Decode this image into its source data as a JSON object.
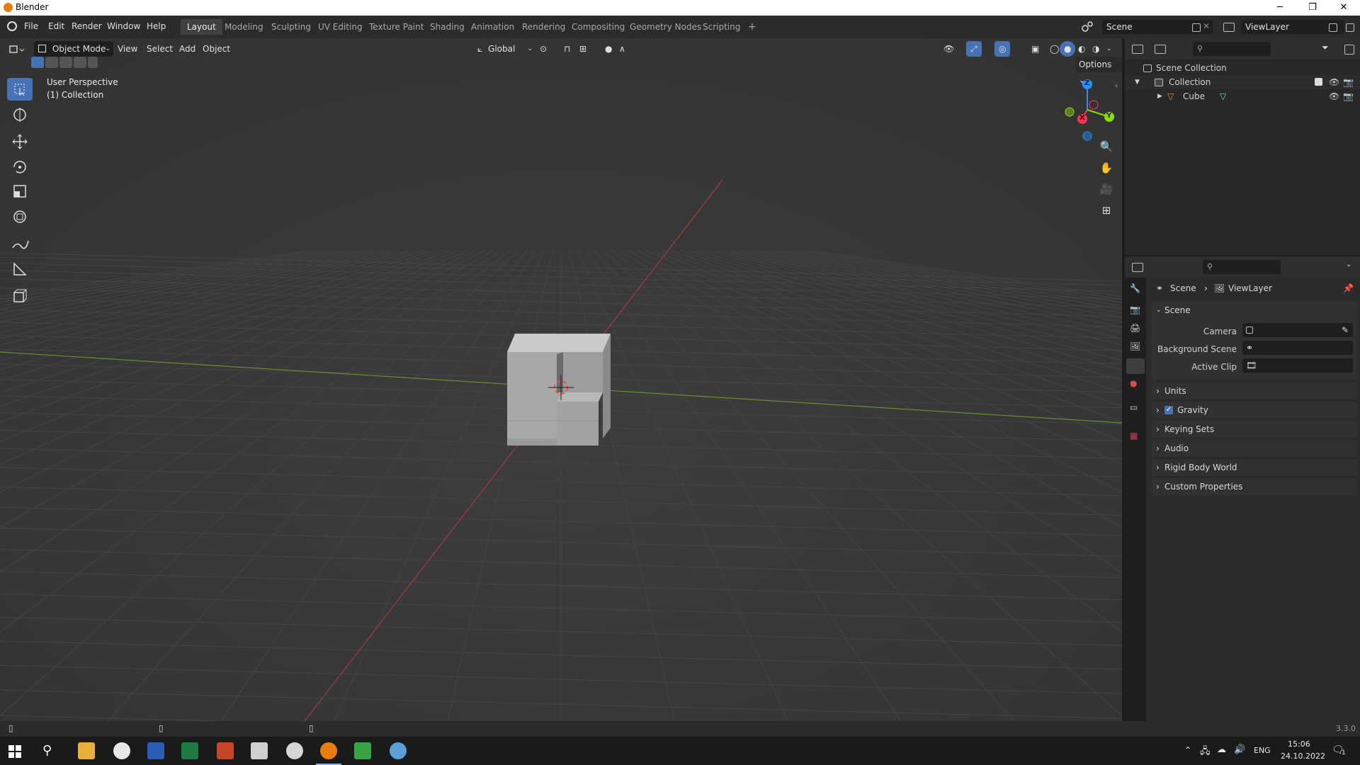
{
  "window": {
    "title": "Blender",
    "controls": [
      "─",
      "❐",
      "✕"
    ]
  },
  "menu": {
    "items": [
      "File",
      "Edit",
      "Render",
      "Window",
      "Help"
    ]
  },
  "workspaces": {
    "tabs": [
      "Layout",
      "Modeling",
      "Sculpting",
      "UV Editing",
      "Texture Paint",
      "Shading",
      "Animation",
      "Rendering",
      "Compositing",
      "Geometry Nodes",
      "Scripting"
    ],
    "add": "+",
    "active": "Layout"
  },
  "scene_selector": {
    "value": "Scene"
  },
  "viewlayer_selector": {
    "value": "ViewLayer"
  },
  "viewport": {
    "mode": "Object Mode",
    "menus": [
      "View",
      "Select",
      "Add",
      "Object"
    ],
    "orientation": "Global",
    "options_label": "Options",
    "info_line1": "User Perspective",
    "info_line2": "(1) Collection",
    "gizmo_axes": {
      "x": "X",
      "y": "Y",
      "z": "Z"
    }
  },
  "outliner": {
    "rows": [
      "Scene Collection",
      "Collection",
      "Cube"
    ]
  },
  "properties": {
    "breadcrumb": [
      "Scene",
      "ViewLayer"
    ],
    "panels": {
      "scene": "Scene",
      "camera_label": "Camera",
      "background_scene_label": "Background Scene",
      "active_clip_label": "Active Clip",
      "units": "Units",
      "gravity": "Gravity",
      "keying_sets": "Keying Sets",
      "audio": "Audio",
      "rigid_body_world": "Rigid Body World",
      "custom_properties": "Custom Properties"
    },
    "gravity_enabled": true
  },
  "statusbar": {
    "version": "3.3.0"
  },
  "taskbar": {
    "language": "ENG",
    "time": "15:06",
    "date": "24.10.2022",
    "notification_count": "1"
  },
  "colors": {
    "accent": "#4772b3",
    "x_axis": "#ff3352",
    "y_axis": "#8bdc00",
    "z_axis": "#2890ff",
    "viewport_bg": "#393939"
  }
}
